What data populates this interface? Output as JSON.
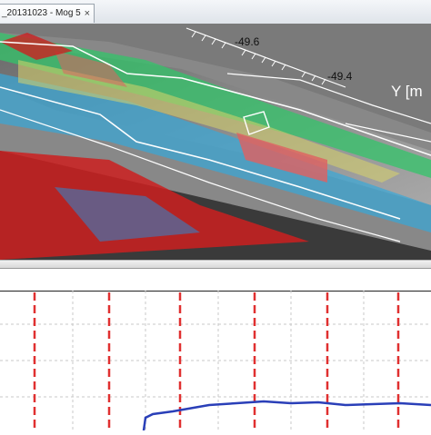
{
  "window": {
    "tab_title": "_20131023 - Mog 5",
    "tab_close_glyph": "×"
  },
  "viewport3d": {
    "axis_ticks": [
      "-49.6",
      "-49.4"
    ],
    "axis_label": "Y [m"
  },
  "profile_plot": {
    "colors": {
      "trace": "#2a3fb8",
      "markers": "#e03030",
      "grid": "#c8c8c8"
    }
  }
}
